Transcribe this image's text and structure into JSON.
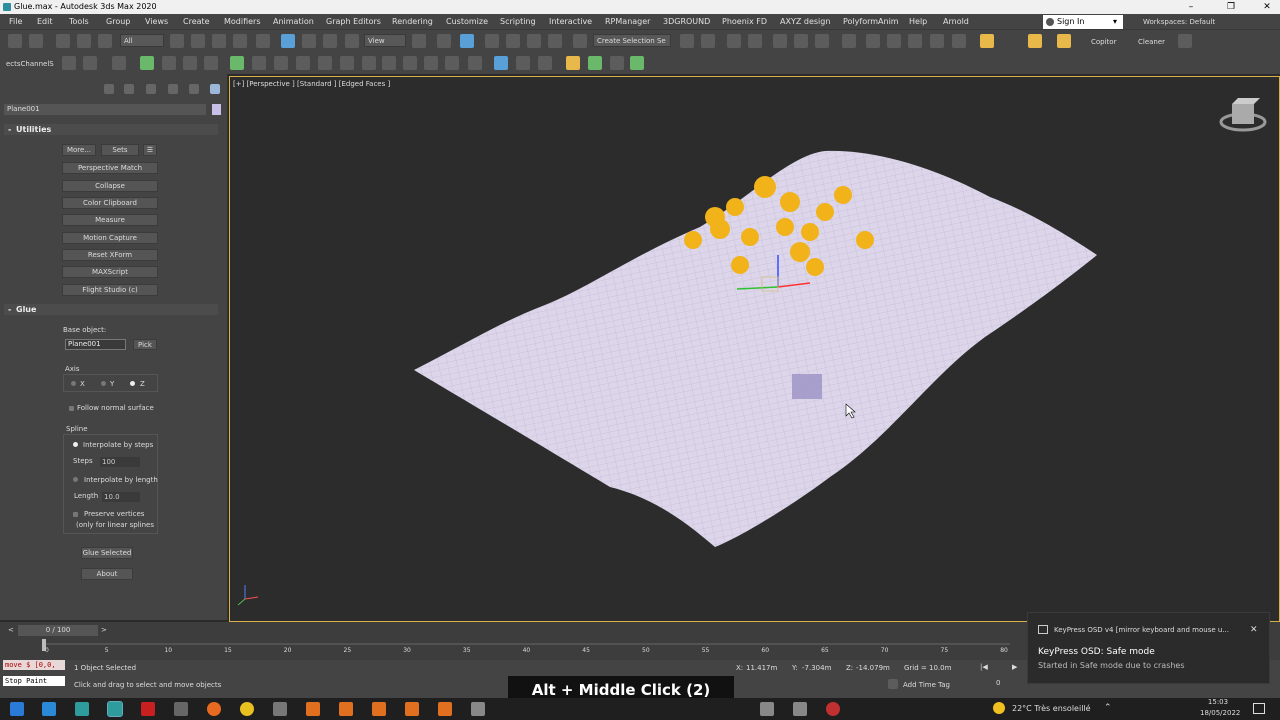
{
  "window": {
    "title": "Glue.max - Autodesk 3ds Max 2020"
  },
  "menus": [
    "File",
    "Edit",
    "Tools",
    "Group",
    "Views",
    "Create",
    "Modifiers",
    "Animation",
    "Graph Editors",
    "Rendering",
    "Customize",
    "Scripting",
    "Interactive",
    "RPManager",
    "3DGROUND",
    "Phoenix FD",
    "AXYZ design",
    "PolyformAnim",
    "Help",
    "Arnold"
  ],
  "signin": {
    "label": "Sign In"
  },
  "workspace": {
    "label": "Workspaces:",
    "value": "Default"
  },
  "toolbar": {
    "filter": "All",
    "refcoord": "View",
    "selection_set": "Create Selection Se",
    "copitor": "Copitor",
    "cleaner": "Cleaner",
    "channels": "ectsChannelS"
  },
  "command_panel": {
    "object_name": "Plane001",
    "utilities_title": "Utilities",
    "more_label": "More...",
    "sets_label": "Sets",
    "utility_buttons": [
      "Perspective Match",
      "Collapse",
      "Color Clipboard",
      "Measure",
      "Motion Capture",
      "Reset XForm",
      "MAXScript",
      "Flight Studio (c)"
    ],
    "glue_title": "Glue",
    "base_object_label": "Base object:",
    "base_object_value": "Plane001",
    "pick_label": "Pick",
    "axis_label": "Axis",
    "axis_x": "X",
    "axis_y": "Y",
    "axis_z": "Z",
    "follow_normal": "Follow normal surface",
    "spline_label": "Spline",
    "interp_steps": "Interpolate by steps",
    "steps_label": "Steps",
    "steps_value": "100",
    "interp_length": "Interpolate by length",
    "length_label": "Length",
    "length_value": "10.0",
    "preserve_vertices": "Preserve vertices",
    "linear_splines": "(only for linear splines",
    "glue_selected": "Glue Selected",
    "about": "About"
  },
  "viewport": {
    "label": "[+] [Perspective ] [Standard ] [Edged Faces ]"
  },
  "timeline": {
    "slider": "0 / 100",
    "ticks": [
      "0",
      "5",
      "10",
      "15",
      "20",
      "25",
      "30",
      "35",
      "40",
      "45",
      "50",
      "55",
      "60",
      "65",
      "70",
      "75",
      "80"
    ]
  },
  "status": {
    "maxscript_line1": "move $ [0,0,",
    "maxscript_line2": "Stop Paint",
    "selected": "1 Object Selected",
    "prompt": "Click and drag to select and move objects",
    "x_label": "X:",
    "x_value": "11.417m",
    "y_label": "Y:",
    "y_value": "-7.304m",
    "z_label": "Z:",
    "z_value": "-14.079m",
    "grid": "Grid = 10.0m",
    "add_time_tag": "Add Time Tag",
    "frame": "0"
  },
  "keypress_osd": "Alt + Middle Click (2)",
  "toast": {
    "app": "KeyPress OSD v4 [mirror keyboard and mouse u...",
    "title": "KeyPress OSD: Safe mode",
    "body": "Started in Safe mode due to crashes"
  },
  "taskbar": {
    "weather": "22°C  Très ensoleillé",
    "time": "15:03",
    "date": "18/05/2022"
  }
}
